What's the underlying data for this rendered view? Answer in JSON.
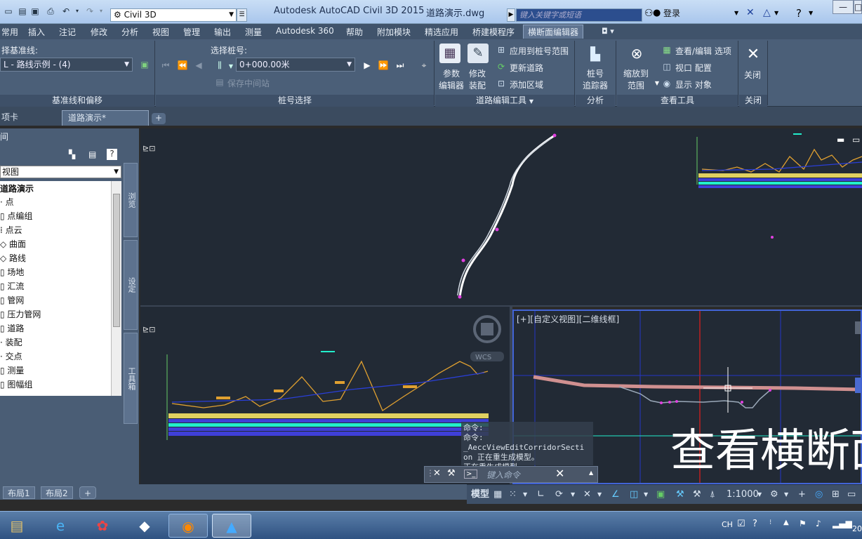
{
  "titlebar": {
    "workspace": "Civil 3D",
    "app_title": "Autodesk AutoCAD Civil 3D 2015",
    "doc_title": "道路演示.dwg",
    "search_placeholder": "键入关键字或短语",
    "signin": "登录"
  },
  "ribbon_tabs": [
    "常用",
    "插入",
    "注记",
    "修改",
    "分析",
    "视图",
    "管理",
    "输出",
    "测量",
    "Autodesk 360",
    "帮助",
    "附加模块",
    "精选应用",
    "桥建模程序",
    "横断面编辑器"
  ],
  "ribbon": {
    "baseline_label": "择基准线:",
    "baseline_value": "L - 路线示例 - (4)",
    "station_label": "选择桩号:",
    "station_value": "0+000.00米",
    "save_in_place": "保存中间站",
    "param_editor": [
      "参数",
      "编辑器"
    ],
    "modify_assembly": [
      "修改",
      "装配"
    ],
    "apply_range": "应用到桩号范围",
    "update_corridor": "更新道路",
    "add_region": "添加区域",
    "station_tracker": [
      "桩号",
      "追踪器"
    ],
    "zoom_extent": [
      "缩放到",
      "范围"
    ],
    "view_edit_options": "查看/编辑 选项",
    "viewport_config": "视口 配置",
    "show_objects": "显示 对象",
    "close": "关闭",
    "panel_baseline": "基准线和偏移",
    "panel_station": "桩号选择",
    "panel_tools": "道路编辑工具",
    "panel_analysis": "分析",
    "panel_view_tools": "查看工具",
    "panel_close": "关闭"
  },
  "doc_tabs": [
    "项卡",
    "道路演示*"
  ],
  "palette": {
    "title": "间",
    "view": "视图",
    "tree": [
      "道路演示",
      "点",
      "点编组",
      "点云",
      "曲面",
      "路线",
      "场地",
      "汇流",
      "管网",
      "压力管网",
      "道路",
      "装配",
      "交点",
      "测量",
      "图幅组"
    ],
    "side_tabs": [
      "浏览",
      "设定",
      "工具箱"
    ]
  },
  "viewport": {
    "label": "[+][自定义视图][二维线框]",
    "ucs": "WCS",
    "overlay_text": "查看横断面"
  },
  "command": {
    "history": [
      "命令:",
      "命令:",
      "_AeccViewEditCorridorSecti",
      "on 正在重生成模型。",
      "正在重生成模型。"
    ],
    "placeholder": "键入命令"
  },
  "layout_tabs": [
    "布局1",
    "布局2"
  ],
  "statusbar": {
    "model": "模型",
    "scale": "1:1000"
  },
  "taskbar": {
    "lang": "CH",
    "clock": "20"
  },
  "colors": {
    "ribbon_bg": "#4b5f78",
    "viewport_bg": "#222a35",
    "road_yellow": "#e0a030",
    "road_blue": "#2a3fd8"
  }
}
